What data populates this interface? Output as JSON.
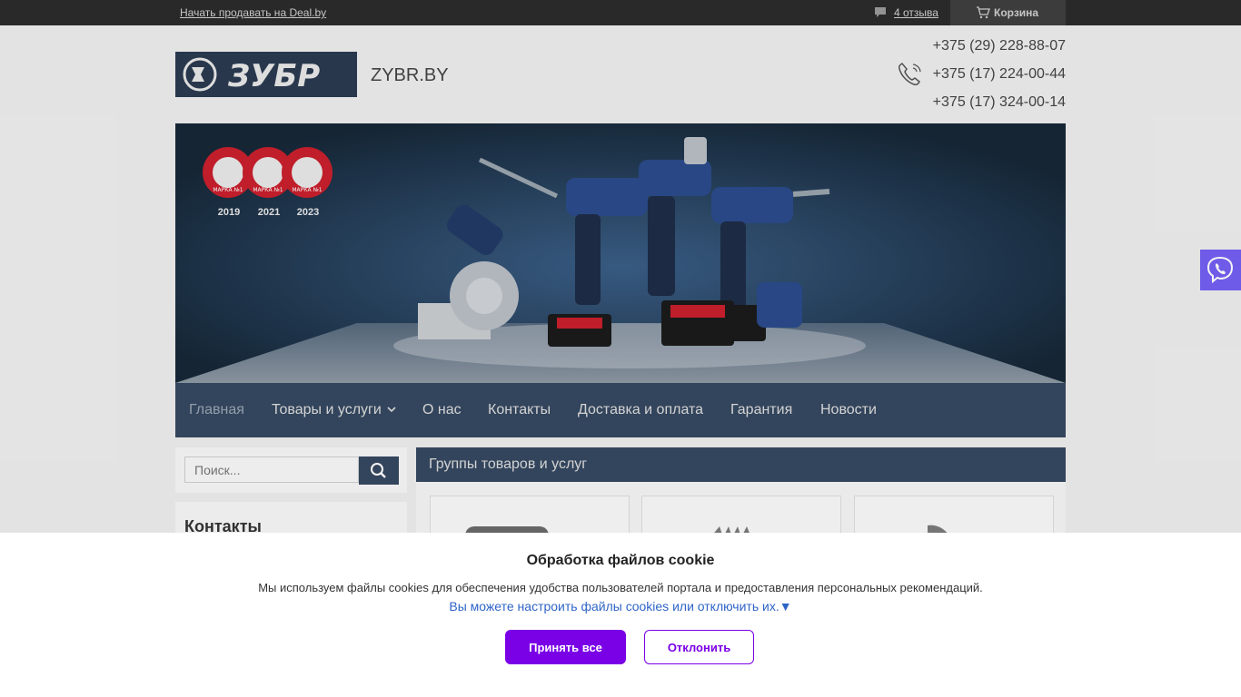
{
  "topbar": {
    "sell_link": "Начать продавать на Deal.by",
    "reviews_link": "4 отзыва",
    "cart_label": "Корзина"
  },
  "header": {
    "site_name": "ZYBR.BY",
    "logo_text": "ЗУБР",
    "phones": [
      "+375 (29) 228-88-07",
      "+375 (17) 224-00-44",
      "+375 (17) 324-00-14"
    ]
  },
  "banner": {
    "award_years": [
      "2019",
      "2021",
      "2023"
    ],
    "award_text": "МАРКА №1"
  },
  "nav": {
    "items": [
      "Главная",
      "Товары и услуги",
      "О нас",
      "Контакты",
      "Доставка и оплата",
      "Гарантия",
      "Новости"
    ]
  },
  "sidebar": {
    "search_placeholder": "Поиск...",
    "contacts_title": "Контакты"
  },
  "main": {
    "groups_title": "Группы товаров и услуг"
  },
  "cookie": {
    "title": "Обработка файлов cookie",
    "text": "Мы используем файлы cookies для обеспечения удобства пользователей портала и предоставления персональных рекомендаций.",
    "settings_link": "Вы можете настроить файлы cookies или отключить их.▼",
    "accept_label": "Принять все",
    "decline_label": "Отклонить"
  },
  "colors": {
    "nav_bg": "#364860",
    "accent_purple": "#7a00e6",
    "viber": "#7360f2",
    "link_blue": "#2f64c7"
  }
}
